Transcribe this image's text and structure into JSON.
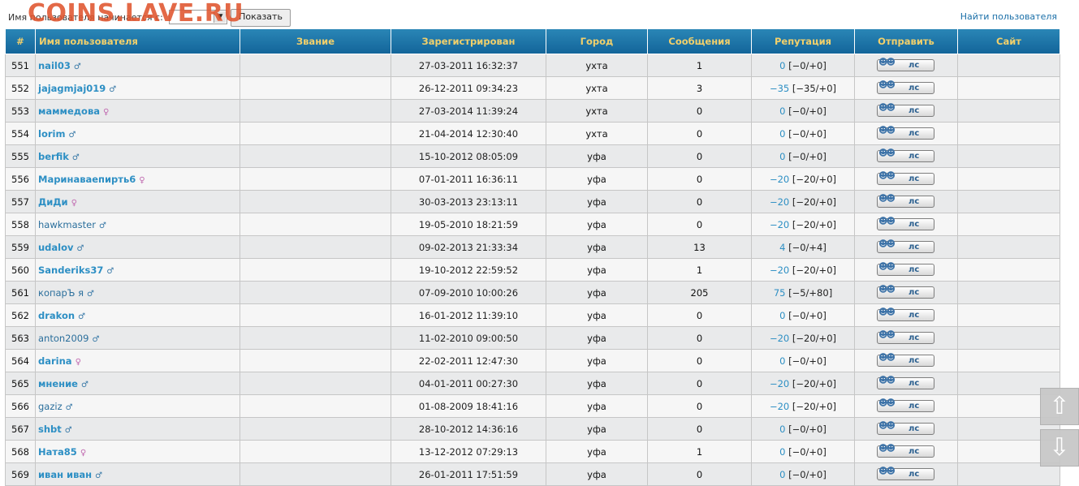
{
  "watermark": "COINS.LAVE.RU",
  "filter": {
    "label": "Имя пользователя начинается с:",
    "show_button": "Показать",
    "select_arrow": "▼"
  },
  "find_user_link": "Найти пользователя",
  "columns": [
    "#",
    "Имя пользователя",
    "Звание",
    "Зарегистрирован",
    "Город",
    "Сообщения",
    "Репутация",
    "Отправить",
    "Сайт"
  ],
  "pm_label": "лс",
  "rows": [
    {
      "num": "551",
      "user": "nail03",
      "bold": true,
      "gender": "m",
      "rank": "",
      "registered": "27-03-2011 16:32:37",
      "city": "ухта",
      "posts": "1",
      "rep": "0",
      "rep_detail": "[−0/+0]",
      "site": ""
    },
    {
      "num": "552",
      "user": "jajagmjaj019",
      "bold": true,
      "gender": "m",
      "rank": "",
      "registered": "26-12-2011 09:34:23",
      "city": "ухта",
      "posts": "3",
      "rep": "−35",
      "rep_detail": "[−35/+0]",
      "site": ""
    },
    {
      "num": "553",
      "user": "маммедова",
      "bold": true,
      "gender": "f",
      "rank": "",
      "registered": "27-03-2014 11:39:24",
      "city": "ухта",
      "posts": "0",
      "rep": "0",
      "rep_detail": "[−0/+0]",
      "site": ""
    },
    {
      "num": "554",
      "user": "lorim",
      "bold": true,
      "gender": "m",
      "rank": "",
      "registered": "21-04-2014 12:30:40",
      "city": "ухта",
      "posts": "0",
      "rep": "0",
      "rep_detail": "[−0/+0]",
      "site": ""
    },
    {
      "num": "555",
      "user": "berfik",
      "bold": true,
      "gender": "m",
      "rank": "",
      "registered": "15-10-2012 08:05:09",
      "city": "уфа",
      "posts": "0",
      "rep": "0",
      "rep_detail": "[−0/+0]",
      "site": ""
    },
    {
      "num": "556",
      "user": "Маринаваепирть6",
      "bold": true,
      "gender": "f",
      "rank": "",
      "registered": "07-01-2011 16:36:11",
      "city": "уфа",
      "posts": "0",
      "rep": "−20",
      "rep_detail": "[−20/+0]",
      "site": ""
    },
    {
      "num": "557",
      "user": "ДиДи",
      "bold": true,
      "gender": "f",
      "rank": "",
      "registered": "30-03-2013 23:13:11",
      "city": "уфа",
      "posts": "0",
      "rep": "−20",
      "rep_detail": "[−20/+0]",
      "site": ""
    },
    {
      "num": "558",
      "user": "hawkmaster",
      "bold": false,
      "gender": "m",
      "rank": "",
      "registered": "19-05-2010 18:21:59",
      "city": "уфа",
      "posts": "0",
      "rep": "−20",
      "rep_detail": "[−20/+0]",
      "site": ""
    },
    {
      "num": "559",
      "user": "udalov",
      "bold": true,
      "gender": "m",
      "rank": "",
      "registered": "09-02-2013 21:33:34",
      "city": "уфа",
      "posts": "13",
      "rep": "4",
      "rep_detail": "[−0/+4]",
      "site": ""
    },
    {
      "num": "560",
      "user": "Sanderiks37",
      "bold": true,
      "gender": "m",
      "rank": "",
      "registered": "19-10-2012 22:59:52",
      "city": "уфа",
      "posts": "1",
      "rep": "−20",
      "rep_detail": "[−20/+0]",
      "site": ""
    },
    {
      "num": "561",
      "user": "копарЪ я",
      "bold": false,
      "gender": "m",
      "rank": "",
      "registered": "07-09-2010 10:00:26",
      "city": "уфа",
      "posts": "205",
      "rep": "75",
      "rep_detail": "[−5/+80]",
      "site": ""
    },
    {
      "num": "562",
      "user": "drakon",
      "bold": true,
      "gender": "m",
      "rank": "",
      "registered": "16-01-2012 11:39:10",
      "city": "уфа",
      "posts": "0",
      "rep": "0",
      "rep_detail": "[−0/+0]",
      "site": ""
    },
    {
      "num": "563",
      "user": "anton2009",
      "bold": false,
      "gender": "m",
      "rank": "",
      "registered": "11-02-2010 09:00:50",
      "city": "уфа",
      "posts": "0",
      "rep": "−20",
      "rep_detail": "[−20/+0]",
      "site": ""
    },
    {
      "num": "564",
      "user": "darina",
      "bold": true,
      "gender": "f",
      "rank": "",
      "registered": "22-02-2011 12:47:30",
      "city": "уфа",
      "posts": "0",
      "rep": "0",
      "rep_detail": "[−0/+0]",
      "site": ""
    },
    {
      "num": "565",
      "user": "мнение",
      "bold": true,
      "gender": "m",
      "rank": "",
      "registered": "04-01-2011 00:27:30",
      "city": "уфа",
      "posts": "0",
      "rep": "−20",
      "rep_detail": "[−20/+0]",
      "site": ""
    },
    {
      "num": "566",
      "user": "gaziz",
      "bold": false,
      "gender": "m",
      "rank": "",
      "registered": "01-08-2009 18:41:16",
      "city": "уфа",
      "posts": "0",
      "rep": "−20",
      "rep_detail": "[−20/+0]",
      "site": ""
    },
    {
      "num": "567",
      "user": "shbt",
      "bold": true,
      "gender": "m",
      "rank": "",
      "registered": "28-10-2012 14:36:16",
      "city": "уфа",
      "posts": "0",
      "rep": "0",
      "rep_detail": "[−0/+0]",
      "site": ""
    },
    {
      "num": "568",
      "user": "Ната85",
      "bold": true,
      "gender": "f",
      "rank": "",
      "registered": "13-12-2012 07:29:13",
      "city": "уфа",
      "posts": "1",
      "rep": "0",
      "rep_detail": "[−0/+0]",
      "site": ""
    },
    {
      "num": "569",
      "user": "иван иван",
      "bold": true,
      "gender": "m",
      "rank": "",
      "registered": "26-01-2011 17:51:59",
      "city": "уфа",
      "posts": "0",
      "rep": "0",
      "rep_detail": "[−0/+0]",
      "site": ""
    }
  ],
  "icons": {
    "male": "♂",
    "female": "♀",
    "pm_faces": "☻☻",
    "scroll_up": "⇧",
    "scroll_down": "⇩"
  },
  "colors": {
    "header_bg": "#16709e",
    "header_text": "#f2d06b",
    "link": "#2d8fc4",
    "watermark": "#e0552e"
  }
}
